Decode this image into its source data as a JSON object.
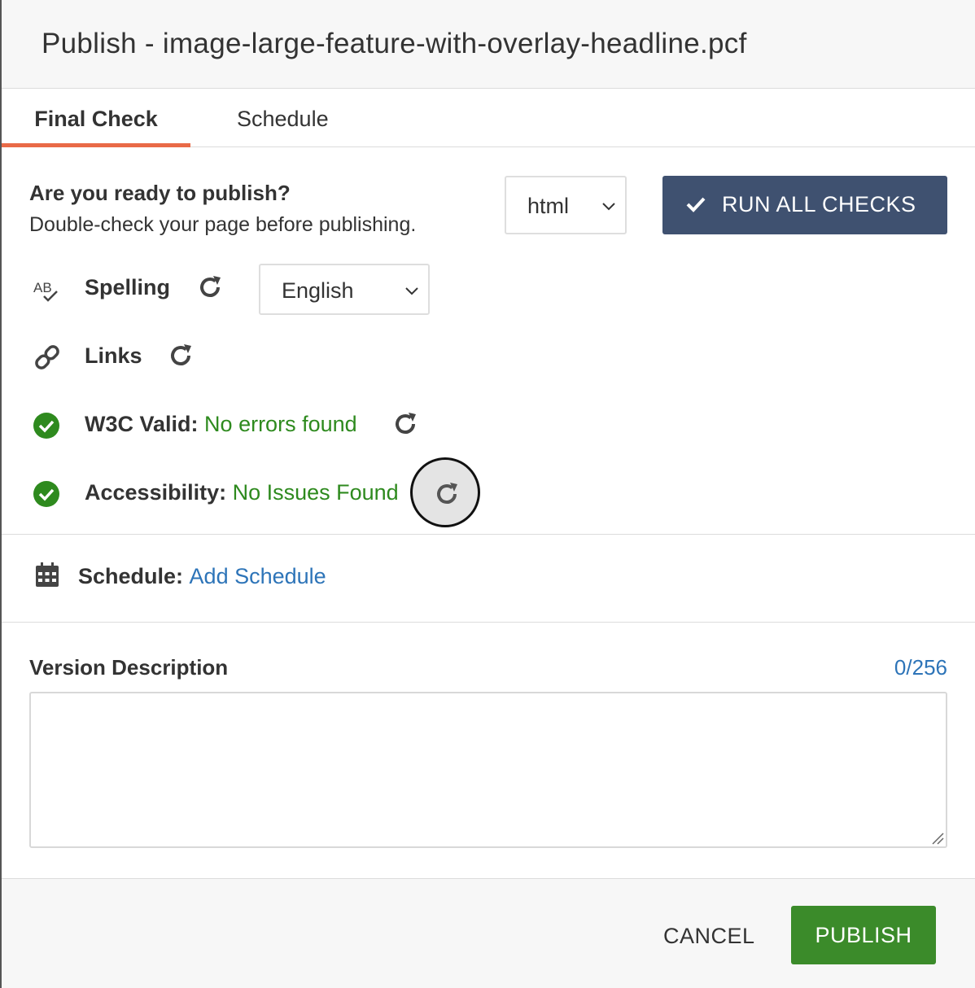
{
  "dialog": {
    "title": "Publish - image-large-feature-with-overlay-headline.pcf"
  },
  "tabs": [
    {
      "label": "Final Check",
      "active": true
    },
    {
      "label": "Schedule",
      "active": false
    }
  ],
  "final_check": {
    "ready_title": "Are you ready to publish?",
    "ready_subtitle": "Double-check your page before publishing.",
    "output_select": {
      "value": "html"
    },
    "run_all_label": "RUN ALL CHECKS",
    "checks": {
      "spelling": {
        "label": "Spelling",
        "icon": "spellcheck-icon",
        "language": "English"
      },
      "links": {
        "label": "Links",
        "icon": "link-icon"
      },
      "w3c": {
        "label": "W3C Valid:",
        "status": "No errors found",
        "icon": "check-circle-icon"
      },
      "accessibility": {
        "label": "Accessibility:",
        "status": "No Issues Found",
        "icon": "check-circle-icon"
      }
    }
  },
  "schedule": {
    "label": "Schedule:",
    "link": "Add Schedule",
    "icon": "calendar-icon"
  },
  "version_description": {
    "label": "Version Description",
    "count": "0/256",
    "value": ""
  },
  "footer": {
    "cancel_label": "CANCEL",
    "publish_label": "PUBLISH"
  },
  "colors": {
    "accent_tab": "#e96a47",
    "primary_button": "#3f5170",
    "success": "#2e8a1e",
    "publish_button": "#3b8b2a",
    "link": "#2d74b8"
  }
}
